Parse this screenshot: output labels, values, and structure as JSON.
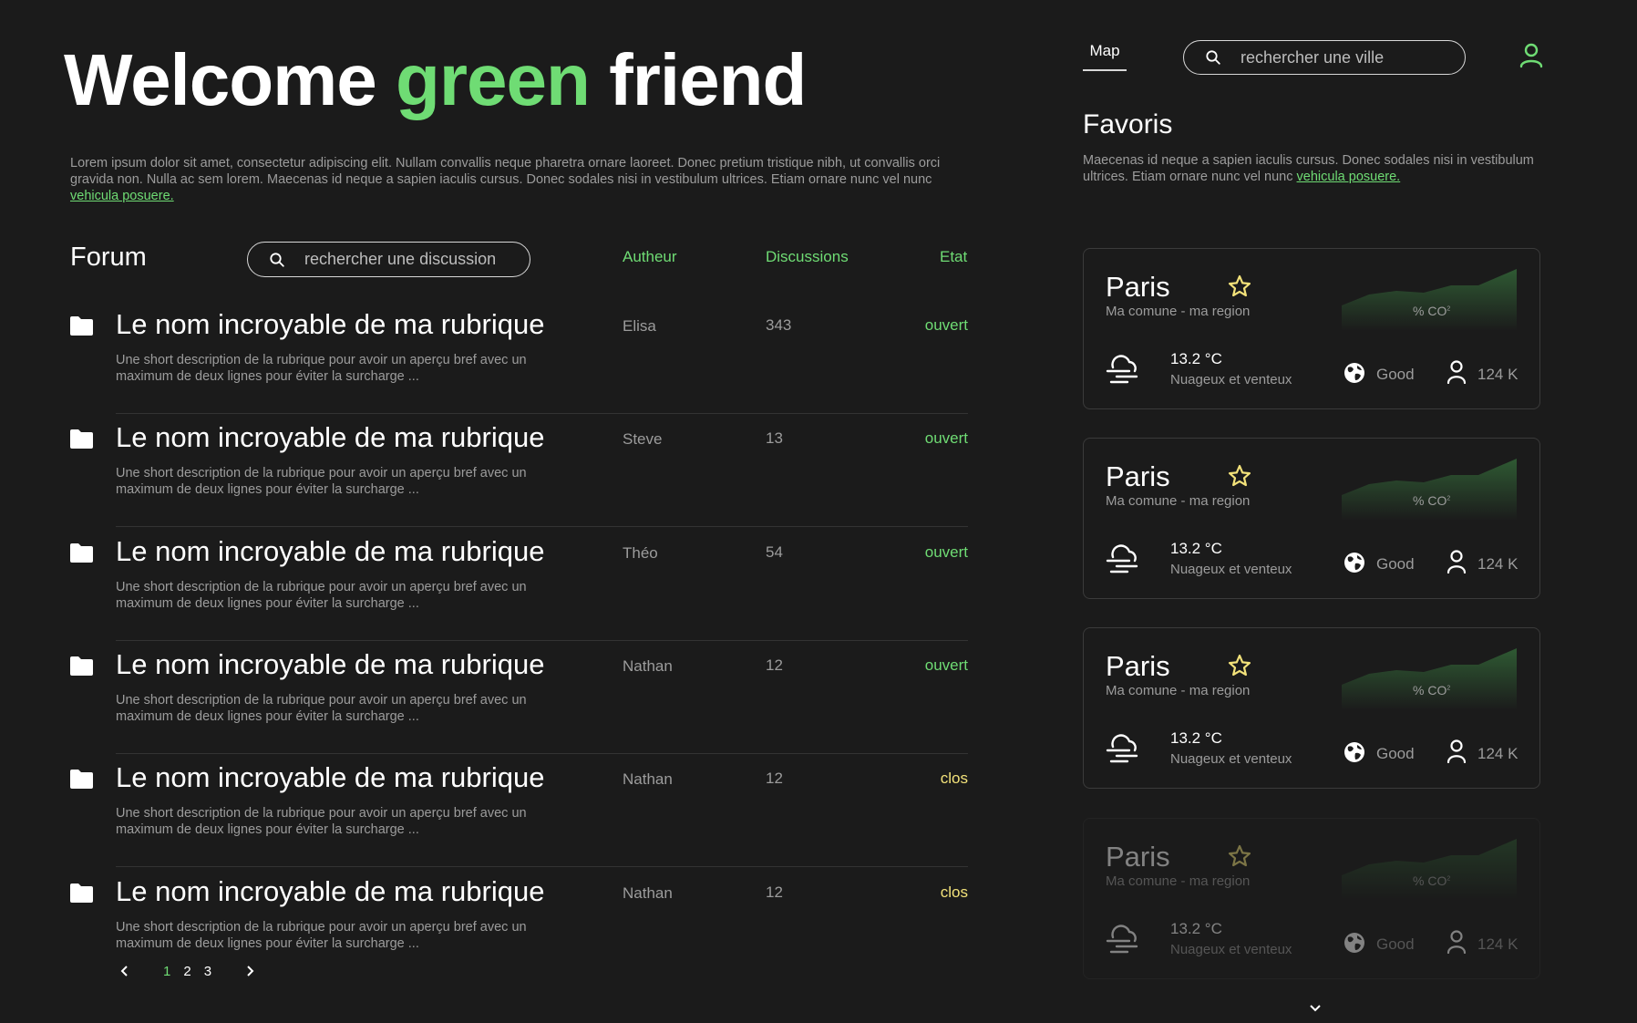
{
  "hero": {
    "title_part1": "Welcome",
    "title_accent": "green",
    "title_part2": "friend",
    "intro_text": "Lorem ipsum dolor sit amet, consectetur adipiscing elit. Nullam convallis neque pharetra ornare laoreet. Donec pretium tristique nibh, ut convallis orci gravida non. Nulla ac sem lorem. Maecenas id neque a sapien iaculis cursus. Donec sodales nisi in vestibulum ultrices. Etiam ornare nunc vel nunc",
    "intro_link": "vehicula posuere."
  },
  "forum": {
    "label": "Forum",
    "search_placeholder": "rechercher une discussion",
    "columns": {
      "author": "Autheur",
      "discussions": "Discussions",
      "state": "Etat"
    },
    "rows": [
      {
        "title": "Le nom incroyable de ma rubrique",
        "description": "Une short description de la rubrique pour avoir un aperçu bref avec un maximum de deux lignes pour éviter la surcharge ...",
        "author": "Elisa",
        "count": "343",
        "state": "ouvert",
        "status": "open"
      },
      {
        "title": "Le nom incroyable de ma rubrique",
        "description": "Une short description de la rubrique pour avoir un aperçu bref avec un maximum de deux lignes pour éviter la surcharge ...",
        "author": "Steve",
        "count": "13",
        "state": "ouvert",
        "status": "open"
      },
      {
        "title": "Le nom incroyable de ma rubrique",
        "description": "Une short description de la rubrique pour avoir un aperçu bref avec un maximum de deux lignes pour éviter la surcharge ...",
        "author": "Théo",
        "count": "54",
        "state": "ouvert",
        "status": "open"
      },
      {
        "title": "Le nom incroyable de ma rubrique",
        "description": "Une short description de la rubrique pour avoir un aperçu bref avec un maximum de deux lignes pour éviter la surcharge ...",
        "author": "Nathan",
        "count": "12",
        "state": "ouvert",
        "status": "open"
      },
      {
        "title": "Le nom incroyable de ma rubrique",
        "description": "Une short description de la rubrique pour avoir un aperçu bref avec un maximum de deux lignes pour éviter la surcharge ...",
        "author": "Nathan",
        "count": "12",
        "state": "clos",
        "status": "closed"
      },
      {
        "title": "Le nom incroyable de ma rubrique",
        "description": "Une short description de la rubrique pour avoir un aperçu bref avec un maximum de deux lignes pour éviter la surcharge ...",
        "author": "Nathan",
        "count": "12",
        "state": "clos",
        "status": "closed"
      }
    ],
    "pagination": {
      "pages": [
        "1",
        "2",
        "3"
      ],
      "current": "1"
    }
  },
  "nav": {
    "map_tab": "Map",
    "city_search_placeholder": "rechercher une ville",
    "user_icon": "user-icon"
  },
  "favorites": {
    "title": "Favoris",
    "description": "Maecenas id neque a sapien iaculis cursus. Donec sodales nisi in vestibulum ultrices. Etiam ornare nunc vel nunc",
    "description_link": "vehicula posuere.",
    "cards": [
      {
        "city": "Paris",
        "region": "Ma comune - ma region",
        "co2_label": "% CO",
        "co2_sup": "2",
        "temperature": "13.2 °C",
        "condition": "Nuageux et venteux",
        "air_quality": "Good",
        "population": "124 K"
      },
      {
        "city": "Paris",
        "region": "Ma comune - ma region",
        "co2_label": "% CO",
        "co2_sup": "2",
        "temperature": "13.2 °C",
        "condition": "Nuageux et venteux",
        "air_quality": "Good",
        "population": "124 K"
      },
      {
        "city": "Paris",
        "region": "Ma comune - ma region",
        "co2_label": "% CO",
        "co2_sup": "2",
        "temperature": "13.2 °C",
        "condition": "Nuageux et venteux",
        "air_quality": "Good",
        "population": "124 K"
      },
      {
        "city": "Paris",
        "region": "Ma comune - ma region",
        "co2_label": "% CO",
        "co2_sup": "2",
        "temperature": "13.2 °C",
        "condition": "Nuageux et venteux",
        "air_quality": "Good",
        "population": "124 K"
      }
    ]
  },
  "colors": {
    "background": "#1b1b1b",
    "accent_green": "#6fdc74",
    "closed_yellow": "#f3e27a",
    "muted_text": "#9c9c9c"
  }
}
